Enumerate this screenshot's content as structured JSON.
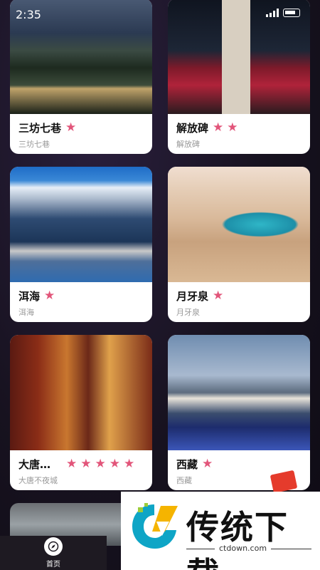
{
  "status_bar": {
    "time": "2:35"
  },
  "cards": [
    {
      "name": "三坊七巷",
      "subtitle": "三坊七巷",
      "stars": 1
    },
    {
      "name": "解放碑",
      "subtitle": "解放碑",
      "stars": 2
    },
    {
      "name": "洱海",
      "subtitle": "洱海",
      "stars": 1
    },
    {
      "name": "月牙泉",
      "subtitle": "月牙泉",
      "stars": 1
    },
    {
      "name": "大唐…",
      "subtitle": "大唐不夜城",
      "stars": 5
    },
    {
      "name": "西藏",
      "subtitle": "西藏",
      "stars": 1
    }
  ],
  "bottom_nav": {
    "home_label": "首页",
    "home_icon": "compass-icon"
  },
  "overlay_brand": {
    "title": "传统下载",
    "url": "ctdown.com",
    "logo_icon": "brand-logo-icon"
  },
  "colors": {
    "star": "#e2557a",
    "background": "#17121f",
    "card": "#ffffff"
  }
}
